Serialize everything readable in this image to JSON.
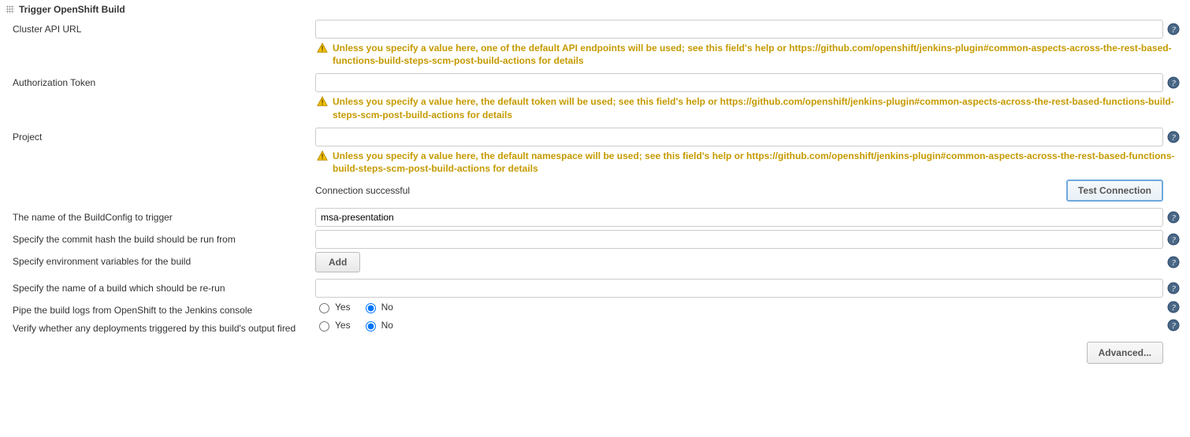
{
  "section_title": "Trigger OpenShift Build",
  "labels": {
    "cluster_api_url": "Cluster API URL",
    "auth_token": "Authorization Token",
    "project": "Project",
    "buildconfig_name": "The name of the BuildConfig to trigger",
    "commit_hash": "Specify the commit hash the build should be run from",
    "env_vars": "Specify environment variables for the build",
    "rerun_build": "Specify the name of a build which should be re-run",
    "pipe_logs": "Pipe the build logs from OpenShift to the Jenkins console",
    "verify_deploy": "Verify whether any deployments triggered by this build's output fired"
  },
  "values": {
    "cluster_api_url": "",
    "auth_token": "",
    "project": "",
    "buildconfig_name": "msa-presentation",
    "commit_hash": "",
    "rerun_build": ""
  },
  "warnings": {
    "cluster_api_url": "Unless you specify a value here, one of the default API endpoints will be used; see this field's help or https://github.com/openshift/jenkins-plugin#common-aspects-across-the-rest-based-functions-build-steps-scm-post-build-actions for details",
    "auth_token": "Unless you specify a value here, the default token will be used; see this field's help or https://github.com/openshift/jenkins-plugin#common-aspects-across-the-rest-based-functions-build-steps-scm-post-build-actions for details",
    "project": "Unless you specify a value here, the default namespace will be used; see this field's help or https://github.com/openshift/jenkins-plugin#common-aspects-across-the-rest-based-functions-build-steps-scm-post-build-actions for details"
  },
  "status": {
    "connection": "Connection successful"
  },
  "buttons": {
    "test_connection": "Test Connection",
    "add": "Add",
    "advanced": "Advanced..."
  },
  "radio": {
    "yes": "Yes",
    "no": "No"
  }
}
